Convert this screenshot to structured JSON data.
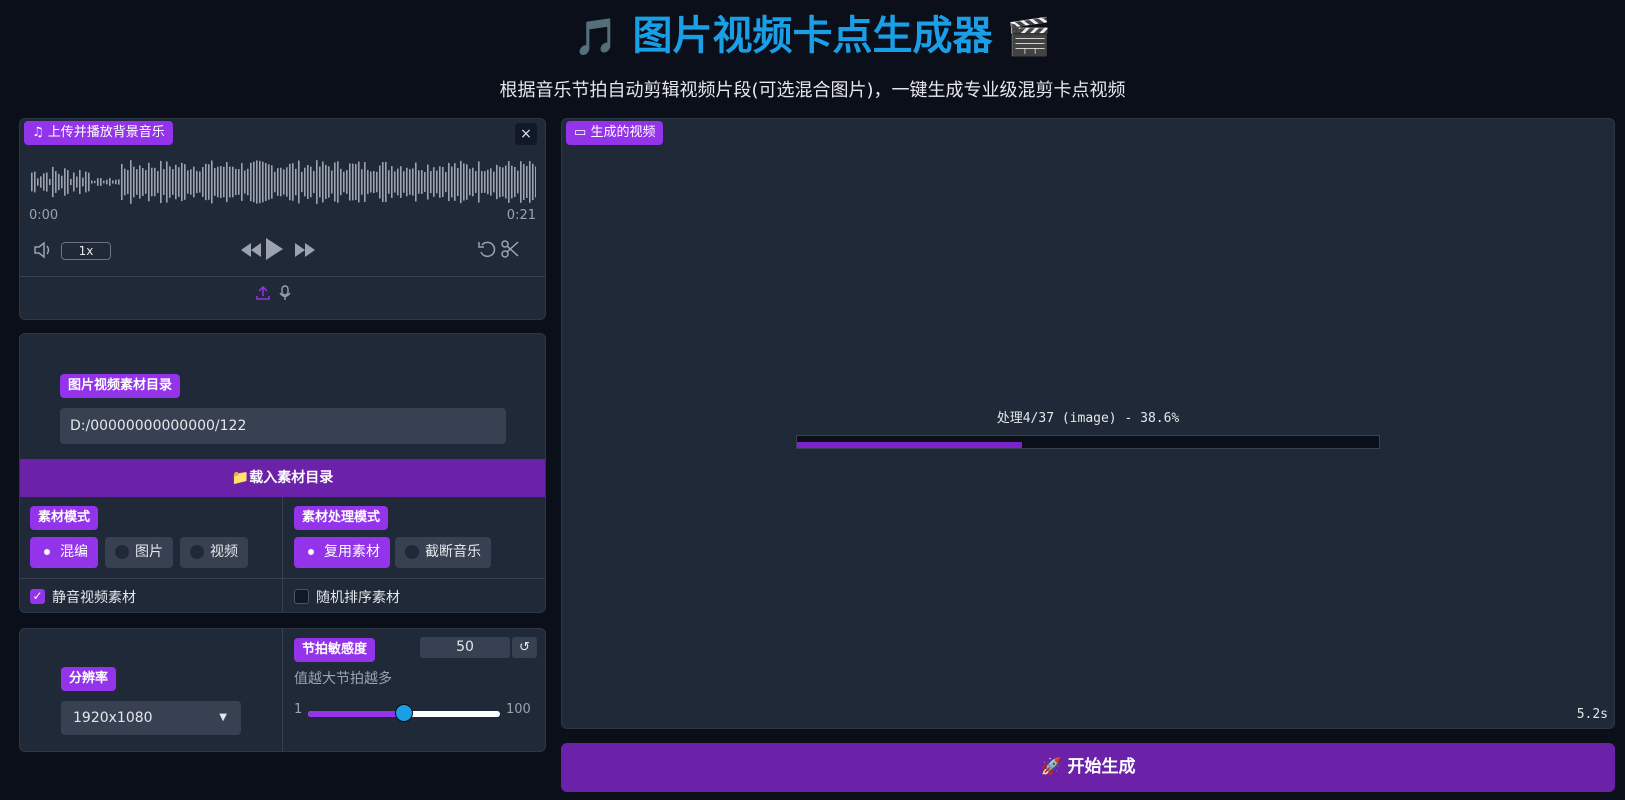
{
  "header": {
    "icon_left": "🎵",
    "title": "图片视频卡点生成器",
    "icon_right": "🎬",
    "subtitle": "根据音乐节拍自动剪辑视频片段(可选混合图片)，一键生成专业级混剪卡点视频"
  },
  "audio": {
    "label": "上传并播放背景音乐",
    "icon": "music-note-icon",
    "close": "×",
    "time_start": "0:00",
    "time_end": "0:21",
    "speed": "1x",
    "waveform_color": "#9ca3af"
  },
  "material": {
    "dir_label": "图片视频素材目录",
    "dir_value": "D:/00000000000000/122",
    "load_button": "载入素材目录",
    "load_icon": "📁",
    "mode_label": "素材模式",
    "mode_options": [
      "混编",
      "图片",
      "视频"
    ],
    "mode_selected": 0,
    "process_label": "素材处理模式",
    "process_options": [
      "复用素材",
      "截断音乐"
    ],
    "process_selected": 0,
    "mute_label": "静音视频素材",
    "mute_checked": true,
    "shuffle_label": "随机排序素材",
    "shuffle_checked": false
  },
  "settings": {
    "resolution_label": "分辨率",
    "resolution_value": "1920x1080",
    "beat_label": "节拍敏感度",
    "beat_value": "50",
    "beat_hint": "值越大节拍越多",
    "slider_min": "1",
    "slider_max": "100",
    "slider_fraction": 0.5
  },
  "video": {
    "label": "生成的视频",
    "progress_text": "处理4/37 (image) - 38.6%",
    "progress_fraction": 0.386,
    "elapsed": "5.2s"
  },
  "generate": {
    "icon": "🚀",
    "label": "开始生成"
  },
  "colors": {
    "accent": "#9333ea",
    "button": "#6b21a8",
    "title": "#1a9fe6"
  }
}
